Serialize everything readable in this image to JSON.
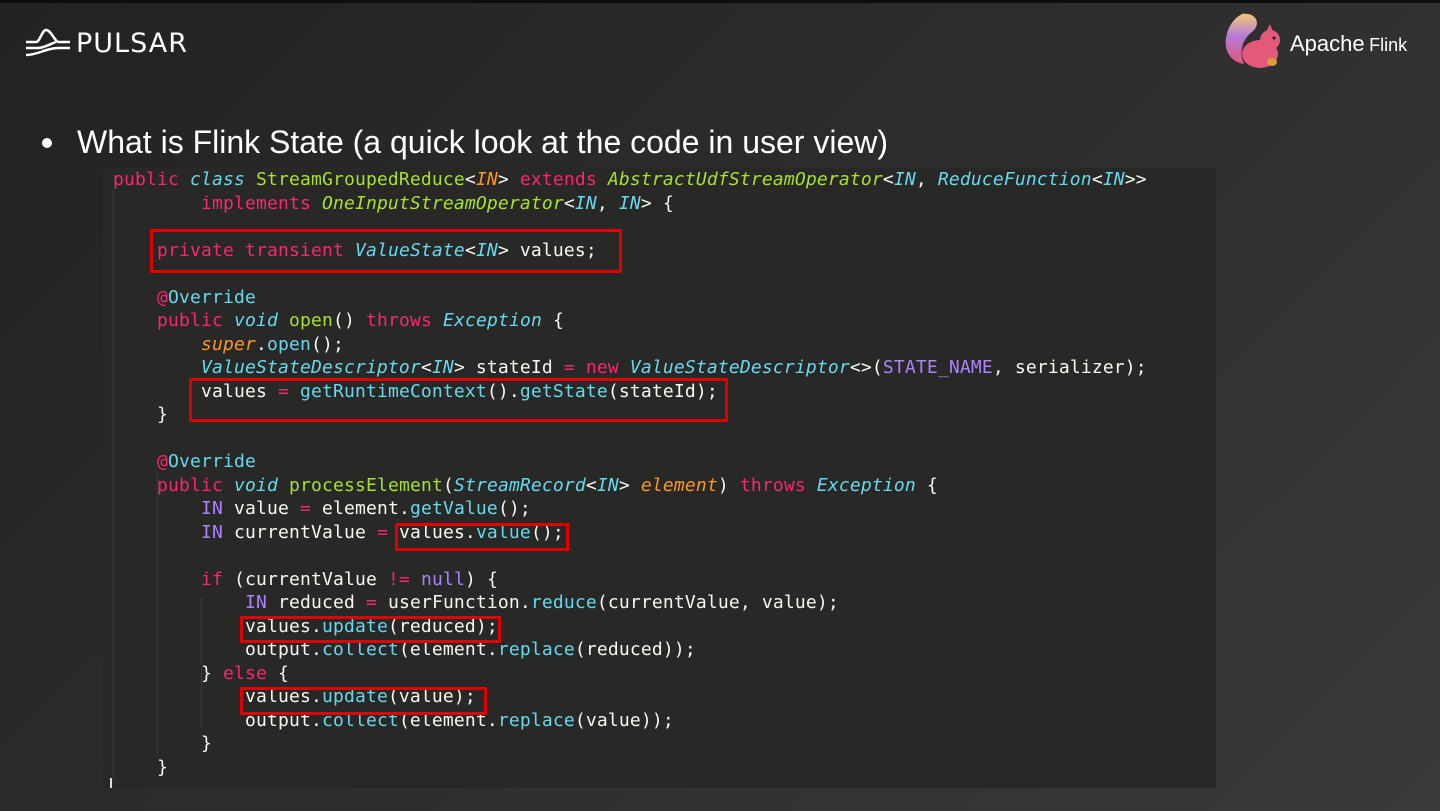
{
  "header": {
    "pulsar_logo": "PULSAR",
    "flink_logo": {
      "apache": "Apache",
      "flink": "Flink"
    }
  },
  "slide": {
    "bullet": "What is Flink State  (a quick look at the code in user view)"
  },
  "colors": {
    "keyword": "#f92672",
    "type": "#66d9ef",
    "name": "#a6e22e",
    "param": "#fd971f",
    "constant": "#ae81ff",
    "highlight": "#e00000"
  },
  "code": [
    [
      [
        "k",
        "public "
      ],
      [
        "t",
        "class "
      ],
      [
        "g",
        "StreamGroupedReduce"
      ],
      [
        "p",
        "<"
      ],
      [
        "o",
        "IN"
      ],
      [
        "p",
        "> "
      ],
      [
        "k",
        "extends "
      ],
      [
        "gi",
        "AbstractUdfStreamOperator"
      ],
      [
        "p",
        "<"
      ],
      [
        "t",
        "IN"
      ],
      [
        "p",
        ", "
      ],
      [
        "t",
        "ReduceFunction"
      ],
      [
        "p",
        "<"
      ],
      [
        "t",
        "IN"
      ],
      [
        "p",
        ">>"
      ]
    ],
    [
      [
        "p",
        "        "
      ],
      [
        "k",
        "implements "
      ],
      [
        "gi",
        "OneInputStreamOperator"
      ],
      [
        "p",
        "<"
      ],
      [
        "t",
        "IN"
      ],
      [
        "p",
        ", "
      ],
      [
        "t",
        "IN"
      ],
      [
        "p",
        "> {"
      ]
    ],
    [],
    [
      [
        "p",
        "    "
      ],
      [
        "k",
        "private transient "
      ],
      [
        "t",
        "ValueState"
      ],
      [
        "p",
        "<"
      ],
      [
        "t",
        "IN"
      ],
      [
        "p",
        "> values;"
      ]
    ],
    [],
    [
      [
        "p",
        "    "
      ],
      [
        "k",
        "@"
      ],
      [
        "c",
        "Override"
      ]
    ],
    [
      [
        "p",
        "    "
      ],
      [
        "k",
        "public "
      ],
      [
        "t",
        "void "
      ],
      [
        "g",
        "open"
      ],
      [
        "p",
        "() "
      ],
      [
        "k",
        "throws "
      ],
      [
        "t",
        "Exception"
      ],
      [
        "p",
        " {"
      ]
    ],
    [
      [
        "p",
        "        "
      ],
      [
        "o",
        "super"
      ],
      [
        "p",
        "."
      ],
      [
        "c",
        "open"
      ],
      [
        "p",
        "();"
      ]
    ],
    [
      [
        "p",
        "        "
      ],
      [
        "t",
        "ValueStateDescriptor"
      ],
      [
        "p",
        "<"
      ],
      [
        "t",
        "IN"
      ],
      [
        "p",
        "> stateId "
      ],
      [
        "k",
        "= new "
      ],
      [
        "t",
        "ValueStateDescriptor"
      ],
      [
        "p",
        "<>("
      ],
      [
        "pu",
        "STATE_NAME"
      ],
      [
        "p",
        ", serializer);"
      ]
    ],
    [
      [
        "p",
        "        values "
      ],
      [
        "k",
        "= "
      ],
      [
        "c",
        "getRuntimeContext"
      ],
      [
        "p",
        "()."
      ],
      [
        "c",
        "getState"
      ],
      [
        "p",
        "(stateId);"
      ]
    ],
    [
      [
        "p",
        "    }"
      ]
    ],
    [],
    [
      [
        "p",
        "    "
      ],
      [
        "k",
        "@"
      ],
      [
        "c",
        "Override"
      ]
    ],
    [
      [
        "p",
        "    "
      ],
      [
        "k",
        "public "
      ],
      [
        "t",
        "void "
      ],
      [
        "g",
        "processElement"
      ],
      [
        "p",
        "("
      ],
      [
        "t",
        "StreamRecord"
      ],
      [
        "p",
        "<"
      ],
      [
        "t",
        "IN"
      ],
      [
        "p",
        "> "
      ],
      [
        "o",
        "element"
      ],
      [
        "p",
        ") "
      ],
      [
        "k",
        "throws "
      ],
      [
        "t",
        "Exception"
      ],
      [
        "p",
        " {"
      ]
    ],
    [
      [
        "p",
        "        "
      ],
      [
        "pu",
        "IN"
      ],
      [
        "p",
        " value "
      ],
      [
        "k",
        "= "
      ],
      [
        "p",
        "element."
      ],
      [
        "c",
        "getValue"
      ],
      [
        "p",
        "();"
      ]
    ],
    [
      [
        "p",
        "        "
      ],
      [
        "pu",
        "IN"
      ],
      [
        "p",
        " currentValue "
      ],
      [
        "k",
        "= "
      ],
      [
        "p",
        "values."
      ],
      [
        "c",
        "value"
      ],
      [
        "p",
        "();"
      ]
    ],
    [],
    [
      [
        "p",
        "        "
      ],
      [
        "k",
        "if "
      ],
      [
        "p",
        "(currentValue "
      ],
      [
        "k",
        "!= "
      ],
      [
        "pu",
        "null"
      ],
      [
        "p",
        ") {"
      ]
    ],
    [
      [
        "p",
        "            "
      ],
      [
        "pu",
        "IN"
      ],
      [
        "p",
        " reduced "
      ],
      [
        "k",
        "= "
      ],
      [
        "p",
        "userFunction."
      ],
      [
        "c",
        "reduce"
      ],
      [
        "p",
        "(currentValue, value);"
      ]
    ],
    [
      [
        "p",
        "            values."
      ],
      [
        "c",
        "update"
      ],
      [
        "p",
        "(reduced);"
      ]
    ],
    [
      [
        "p",
        "            output."
      ],
      [
        "c",
        "collect"
      ],
      [
        "p",
        "(element."
      ],
      [
        "c",
        "replace"
      ],
      [
        "p",
        "(reduced));"
      ]
    ],
    [
      [
        "p",
        "        } "
      ],
      [
        "k",
        "else "
      ],
      [
        "p",
        "{"
      ]
    ],
    [
      [
        "p",
        "            values."
      ],
      [
        "c",
        "update"
      ],
      [
        "p",
        "(value);"
      ]
    ],
    [
      [
        "p",
        "            output."
      ],
      [
        "c",
        "collect"
      ],
      [
        "p",
        "(element."
      ],
      [
        "c",
        "replace"
      ],
      [
        "p",
        "(value));"
      ]
    ],
    [
      [
        "p",
        "        }"
      ]
    ],
    [
      [
        "p",
        "    }"
      ]
    ]
  ]
}
